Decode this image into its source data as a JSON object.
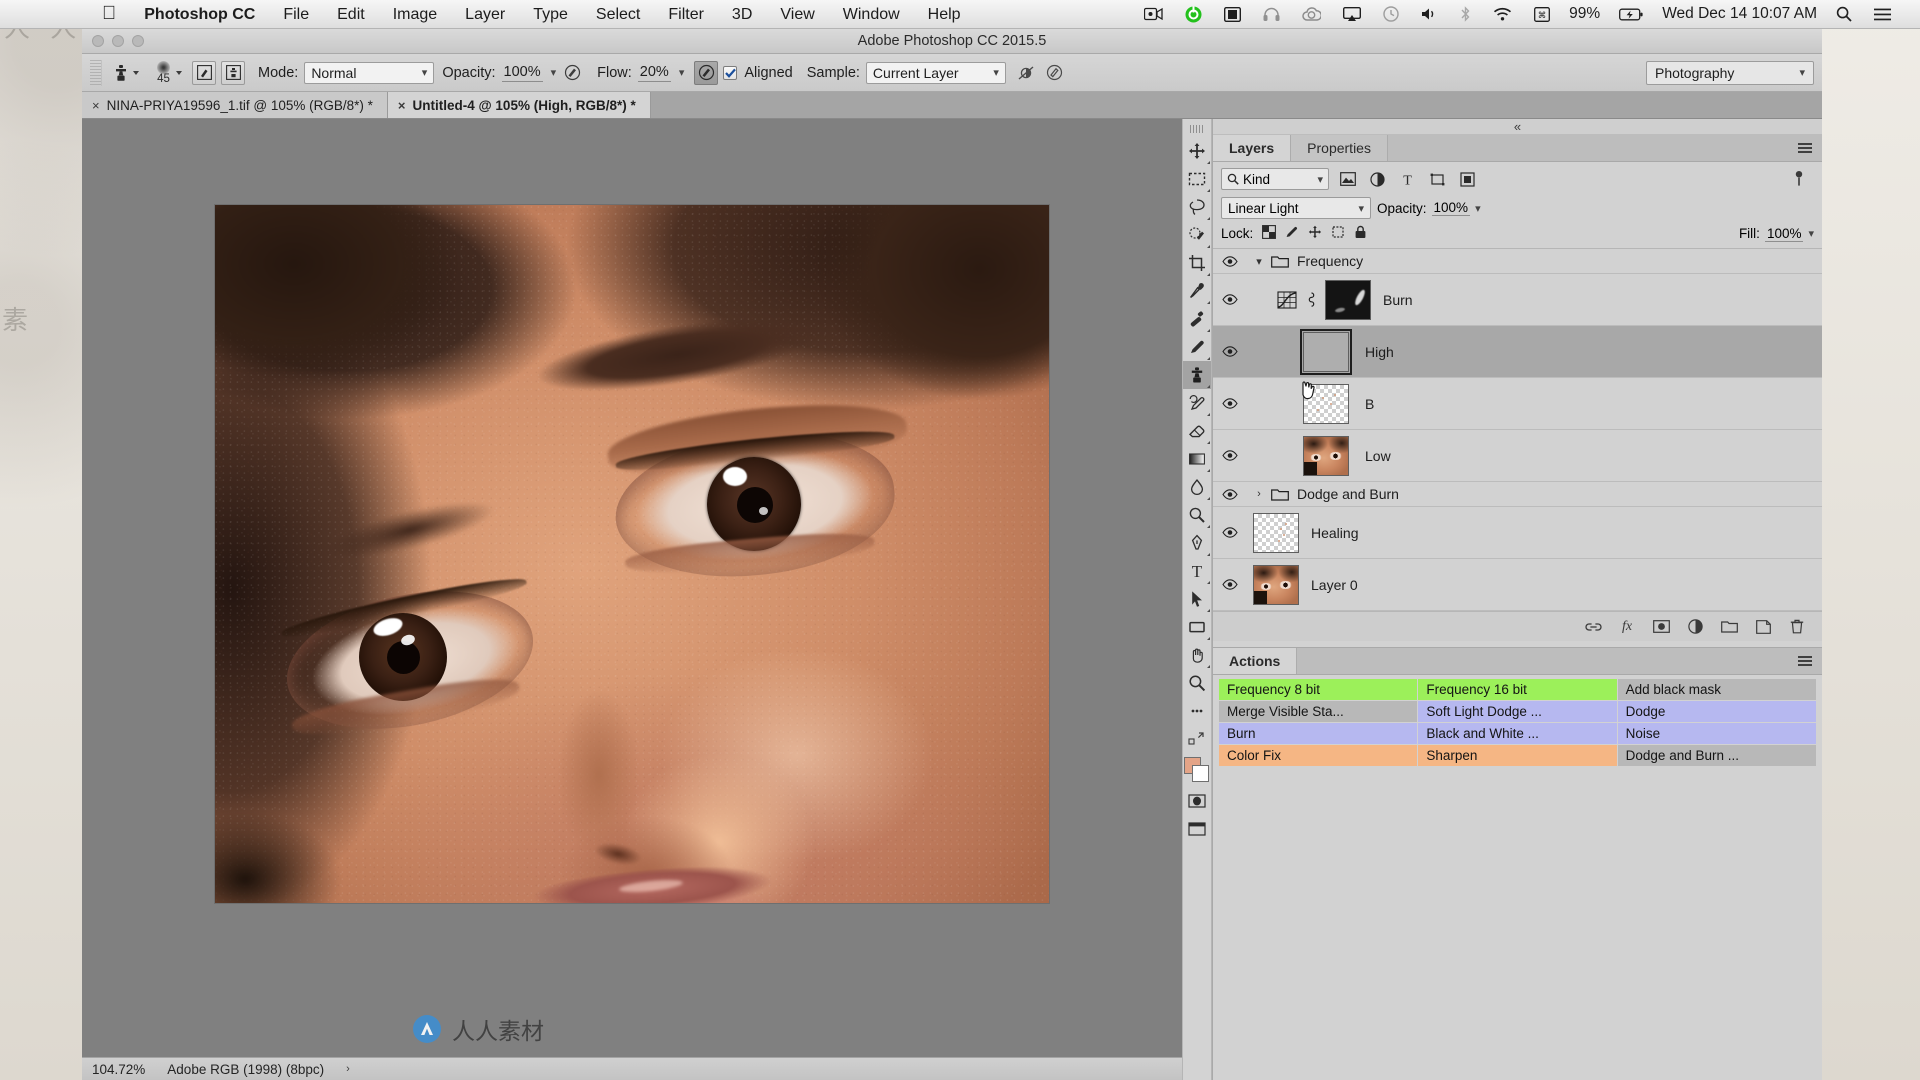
{
  "menubar": {
    "apple": "apple-logo",
    "app": "Photoshop CC",
    "items": [
      "File",
      "Edit",
      "Image",
      "Layer",
      "Type",
      "Select",
      "Filter",
      "3D",
      "View",
      "Window",
      "Help"
    ],
    "status_icons": [
      "screen-record-icon",
      "green-circle-icon",
      "display-icon",
      "headphones-icon",
      "creative-cloud-icon",
      "airplay-icon",
      "timemachine-icon",
      "volume-icon",
      "bluetooth-icon",
      "wifi-icon",
      "keyboard-input-icon"
    ],
    "battery_percent": "99%",
    "battery_icon": "battery-charging-icon",
    "clock": "Wed Dec 14  10:07 AM",
    "spotlight_icon": "search-icon",
    "notification_icon": "list-icon"
  },
  "window": {
    "title": "Adobe Photoshop CC 2015.5"
  },
  "options_bar": {
    "tool_icon": "clone-stamp-icon",
    "brush_size": "45",
    "toggle_brush_panel_icon": "brush-panel-icon",
    "toggle_clone_source_icon": "clone-source-icon",
    "mode_label": "Mode:",
    "mode_value": "Normal",
    "opacity_label": "Opacity:",
    "opacity_value": "100%",
    "pressure_opacity_icon": "pressure-opacity-icon",
    "flow_label": "Flow:",
    "flow_value": "20%",
    "airbrush_icon": "airbrush-icon",
    "aligned_label": "Aligned",
    "aligned_checked": true,
    "sample_label": "Sample:",
    "sample_value": "Current Layer",
    "ignore_adjustment_icon": "ignore-adjustment-layers-icon",
    "tablet_pressure_icon": "tablet-pressure-icon",
    "workspace": "Photography"
  },
  "tabs": [
    {
      "label": "NINA-PRIYA19596_1.tif @ 105% (RGB/8*) *",
      "active": false
    },
    {
      "label": "Untitled-4 @ 105% (High, RGB/8*) *",
      "active": true
    }
  ],
  "status_bar": {
    "zoom": "104.72%",
    "profile": "Adobe RGB (1998) (8bpc)",
    "chevron": "chevron-right-icon"
  },
  "tools": [
    {
      "name": "move-tool",
      "icon": "move-icon",
      "selected": false
    },
    {
      "name": "marquee-tool",
      "icon": "rectangular-marquee-icon",
      "selected": false
    },
    {
      "name": "lasso-tool",
      "icon": "lasso-icon",
      "selected": false
    },
    {
      "name": "quick-selection-tool",
      "icon": "quick-selection-icon",
      "selected": false
    },
    {
      "name": "crop-tool",
      "icon": "crop-icon",
      "selected": false
    },
    {
      "name": "eyedropper-tool",
      "icon": "eyedropper-icon",
      "selected": false
    },
    {
      "name": "spot-healing-tool",
      "icon": "healing-brush-icon",
      "selected": false
    },
    {
      "name": "brush-tool",
      "icon": "brush-icon",
      "selected": false
    },
    {
      "name": "clone-stamp-tool",
      "icon": "clone-stamp-icon",
      "selected": true
    },
    {
      "name": "history-brush-tool",
      "icon": "history-brush-icon",
      "selected": false
    },
    {
      "name": "eraser-tool",
      "icon": "eraser-icon",
      "selected": false
    },
    {
      "name": "gradient-tool",
      "icon": "gradient-icon",
      "selected": false
    },
    {
      "name": "blur-tool",
      "icon": "blur-drop-icon",
      "selected": false
    },
    {
      "name": "dodge-tool",
      "icon": "dodge-icon",
      "selected": false
    },
    {
      "name": "pen-tool",
      "icon": "pen-icon",
      "selected": false
    },
    {
      "name": "type-tool",
      "icon": "type-icon",
      "selected": false
    },
    {
      "name": "path-selection-tool",
      "icon": "path-selection-arrow-icon",
      "selected": false
    },
    {
      "name": "shape-tool",
      "icon": "rectangle-shape-icon",
      "selected": false
    },
    {
      "name": "hand-tool",
      "icon": "hand-icon",
      "selected": false
    },
    {
      "name": "zoom-tool",
      "icon": "zoom-magnifier-icon",
      "selected": false
    },
    {
      "name": "edit-toolbar",
      "icon": "ellipsis-icon",
      "selected": false
    }
  ],
  "tool_extras": {
    "quick-mask-icon": "quick-mask-mode",
    "screen-mode-icon": "screen-mode"
  },
  "panels": {
    "collapse_icon": "collapse-panels-icon",
    "tabs": [
      {
        "label": "Layers",
        "active": true
      },
      {
        "label": "Properties",
        "active": false
      }
    ],
    "menu_icon": "panel-menu-icon"
  },
  "layers_panel": {
    "filter_kind_label": "Kind",
    "filter_kind_icon": "search-icon",
    "filter_icons": [
      "pixel-filter-icon",
      "adjustment-filter-icon",
      "type-filter-icon",
      "shape-filter-icon",
      "smartobject-filter-icon",
      "filter-toggle-icon"
    ],
    "blend_mode": "Linear Light",
    "opacity_label": "Opacity:",
    "opacity_value": "100%",
    "lock_label": "Lock:",
    "lock_icons": [
      "lock-transparent-pixels-icon",
      "lock-image-pixels-icon",
      "lock-position-icon",
      "lock-artboard-icon",
      "lock-all-icon"
    ],
    "fill_label": "Fill:",
    "fill_value": "100%",
    "layers": [
      {
        "name": "Frequency",
        "type": "group",
        "expanded": true,
        "visible": true,
        "selected": false,
        "thumb": "none"
      },
      {
        "name": "Burn",
        "type": "adjustment",
        "visible": true,
        "selected": false,
        "thumb": "black-mask",
        "has_link": true,
        "adj_icon": "curves-icon"
      },
      {
        "name": "High",
        "type": "pixel",
        "visible": true,
        "selected": true,
        "thumb": "gray"
      },
      {
        "name": "B",
        "type": "pixel",
        "visible": true,
        "selected": false,
        "thumb": "transparent-dust"
      },
      {
        "name": "Low",
        "type": "pixel",
        "visible": true,
        "selected": false,
        "thumb": "face"
      },
      {
        "name": "Dodge and Burn",
        "type": "group",
        "expanded": false,
        "visible": true,
        "selected": false,
        "thumb": "none"
      },
      {
        "name": "Healing",
        "type": "pixel",
        "visible": true,
        "selected": false,
        "thumb": "transparent-dust"
      },
      {
        "name": "Layer 0",
        "type": "pixel",
        "visible": true,
        "selected": false,
        "thumb": "face"
      }
    ],
    "footer_icons": [
      "link-layers-icon",
      "layer-style-fx-icon",
      "add-mask-icon",
      "adjustment-layer-icon",
      "new-group-icon",
      "new-layer-icon",
      "delete-layer-icon"
    ],
    "footer_fx_label": "fx"
  },
  "actions_panel": {
    "tab_label": "Actions",
    "menu_icon": "panel-menu-icon",
    "colors": {
      "green": "#9cf05a",
      "blue": "#b6b8f0",
      "orange": "#f5b684",
      "gray": "#b8b8b8"
    },
    "rows": [
      [
        {
          "label": "Frequency 8 bit",
          "color": "green"
        },
        {
          "label": "Frequency 16 bit",
          "color": "green"
        },
        {
          "label": "Add black mask",
          "color": "gray"
        }
      ],
      [
        {
          "label": "Merge Visible Sta...",
          "color": "gray"
        },
        {
          "label": "Soft Light Dodge ...",
          "color": "blue"
        },
        {
          "label": "Dodge",
          "color": "blue"
        }
      ],
      [
        {
          "label": "Burn",
          "color": "blue"
        },
        {
          "label": "Black and White ...",
          "color": "blue"
        },
        {
          "label": "Noise",
          "color": "blue"
        }
      ],
      [
        {
          "label": "Color Fix",
          "color": "orange"
        },
        {
          "label": "Sharpen",
          "color": "orange"
        },
        {
          "label": "Dodge and Burn ...",
          "color": "gray"
        }
      ]
    ]
  },
  "watermark": {
    "text": "人人素材",
    "logo": "watermark-logo-icon"
  }
}
